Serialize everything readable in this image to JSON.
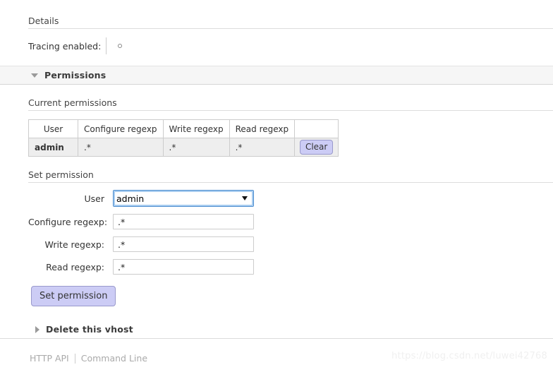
{
  "details": {
    "heading": "Details",
    "rows": [
      {
        "label": "Tracing enabled:",
        "value_icon": "empty-circle-indicator"
      }
    ]
  },
  "permissions_section": {
    "band_title": "Permissions",
    "toggle_icon": "triangle-down-icon",
    "expanded": true,
    "current": {
      "heading": "Current permissions",
      "columns": [
        "User",
        "Configure regexp",
        "Write regexp",
        "Read regexp",
        ""
      ],
      "rows": [
        {
          "user": "admin",
          "configure": ".*",
          "write": ".*",
          "read": ".*",
          "action_label": "Clear"
        }
      ]
    },
    "set": {
      "heading": "Set permission",
      "fields": [
        {
          "label": "User",
          "type": "select",
          "value": "admin",
          "options": [
            "admin"
          ]
        },
        {
          "label": "Configure regexp:",
          "type": "text",
          "value": ".*"
        },
        {
          "label": "Write regexp:",
          "type": "text",
          "value": ".*"
        },
        {
          "label": "Read regexp:",
          "type": "text",
          "value": ".*"
        }
      ],
      "submit_label": "Set permission"
    }
  },
  "delete_section": {
    "band_title": "Delete this vhost",
    "toggle_icon": "triangle-right-icon",
    "expanded": false
  },
  "footer": {
    "links": [
      {
        "label": "HTTP API"
      },
      {
        "label": "Command Line"
      }
    ]
  },
  "watermark": {
    "text": "https://blog.csdn.net/luwei42768"
  },
  "colors": {
    "accent_button_bg": "#ccccf5",
    "accent_button_border": "#9999cc",
    "band_bg": "#f6f6f6",
    "table_row_bg": "#eeeeee",
    "focus_border": "#4f8fd0",
    "page_bg": "#ffffff"
  }
}
